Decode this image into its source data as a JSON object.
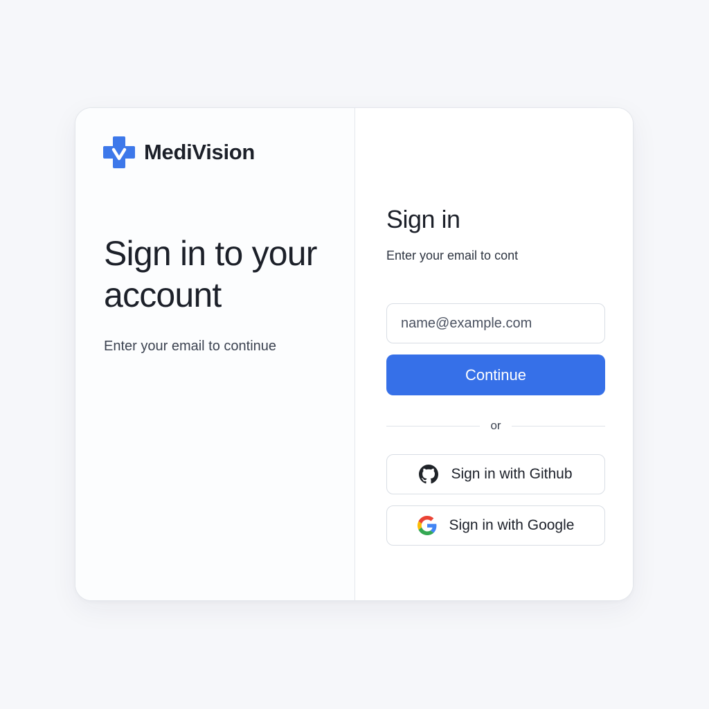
{
  "brand": {
    "name": "MediVision",
    "logo_icon": "medical-cross-check-icon",
    "accent_color": "#3670e8"
  },
  "left": {
    "title": "Sign in to your account",
    "subtitle": "Enter your email to continue"
  },
  "right": {
    "title": "Sign in",
    "subtitle": "Enter your email to cont",
    "email": {
      "value": "",
      "placeholder": "name@example.com"
    },
    "continue_label": "Continue",
    "divider_label": "or",
    "github": {
      "label": "Sign in with Github",
      "icon": "github-icon"
    },
    "google": {
      "label": "Sign in with Google",
      "icon": "google-icon"
    }
  }
}
